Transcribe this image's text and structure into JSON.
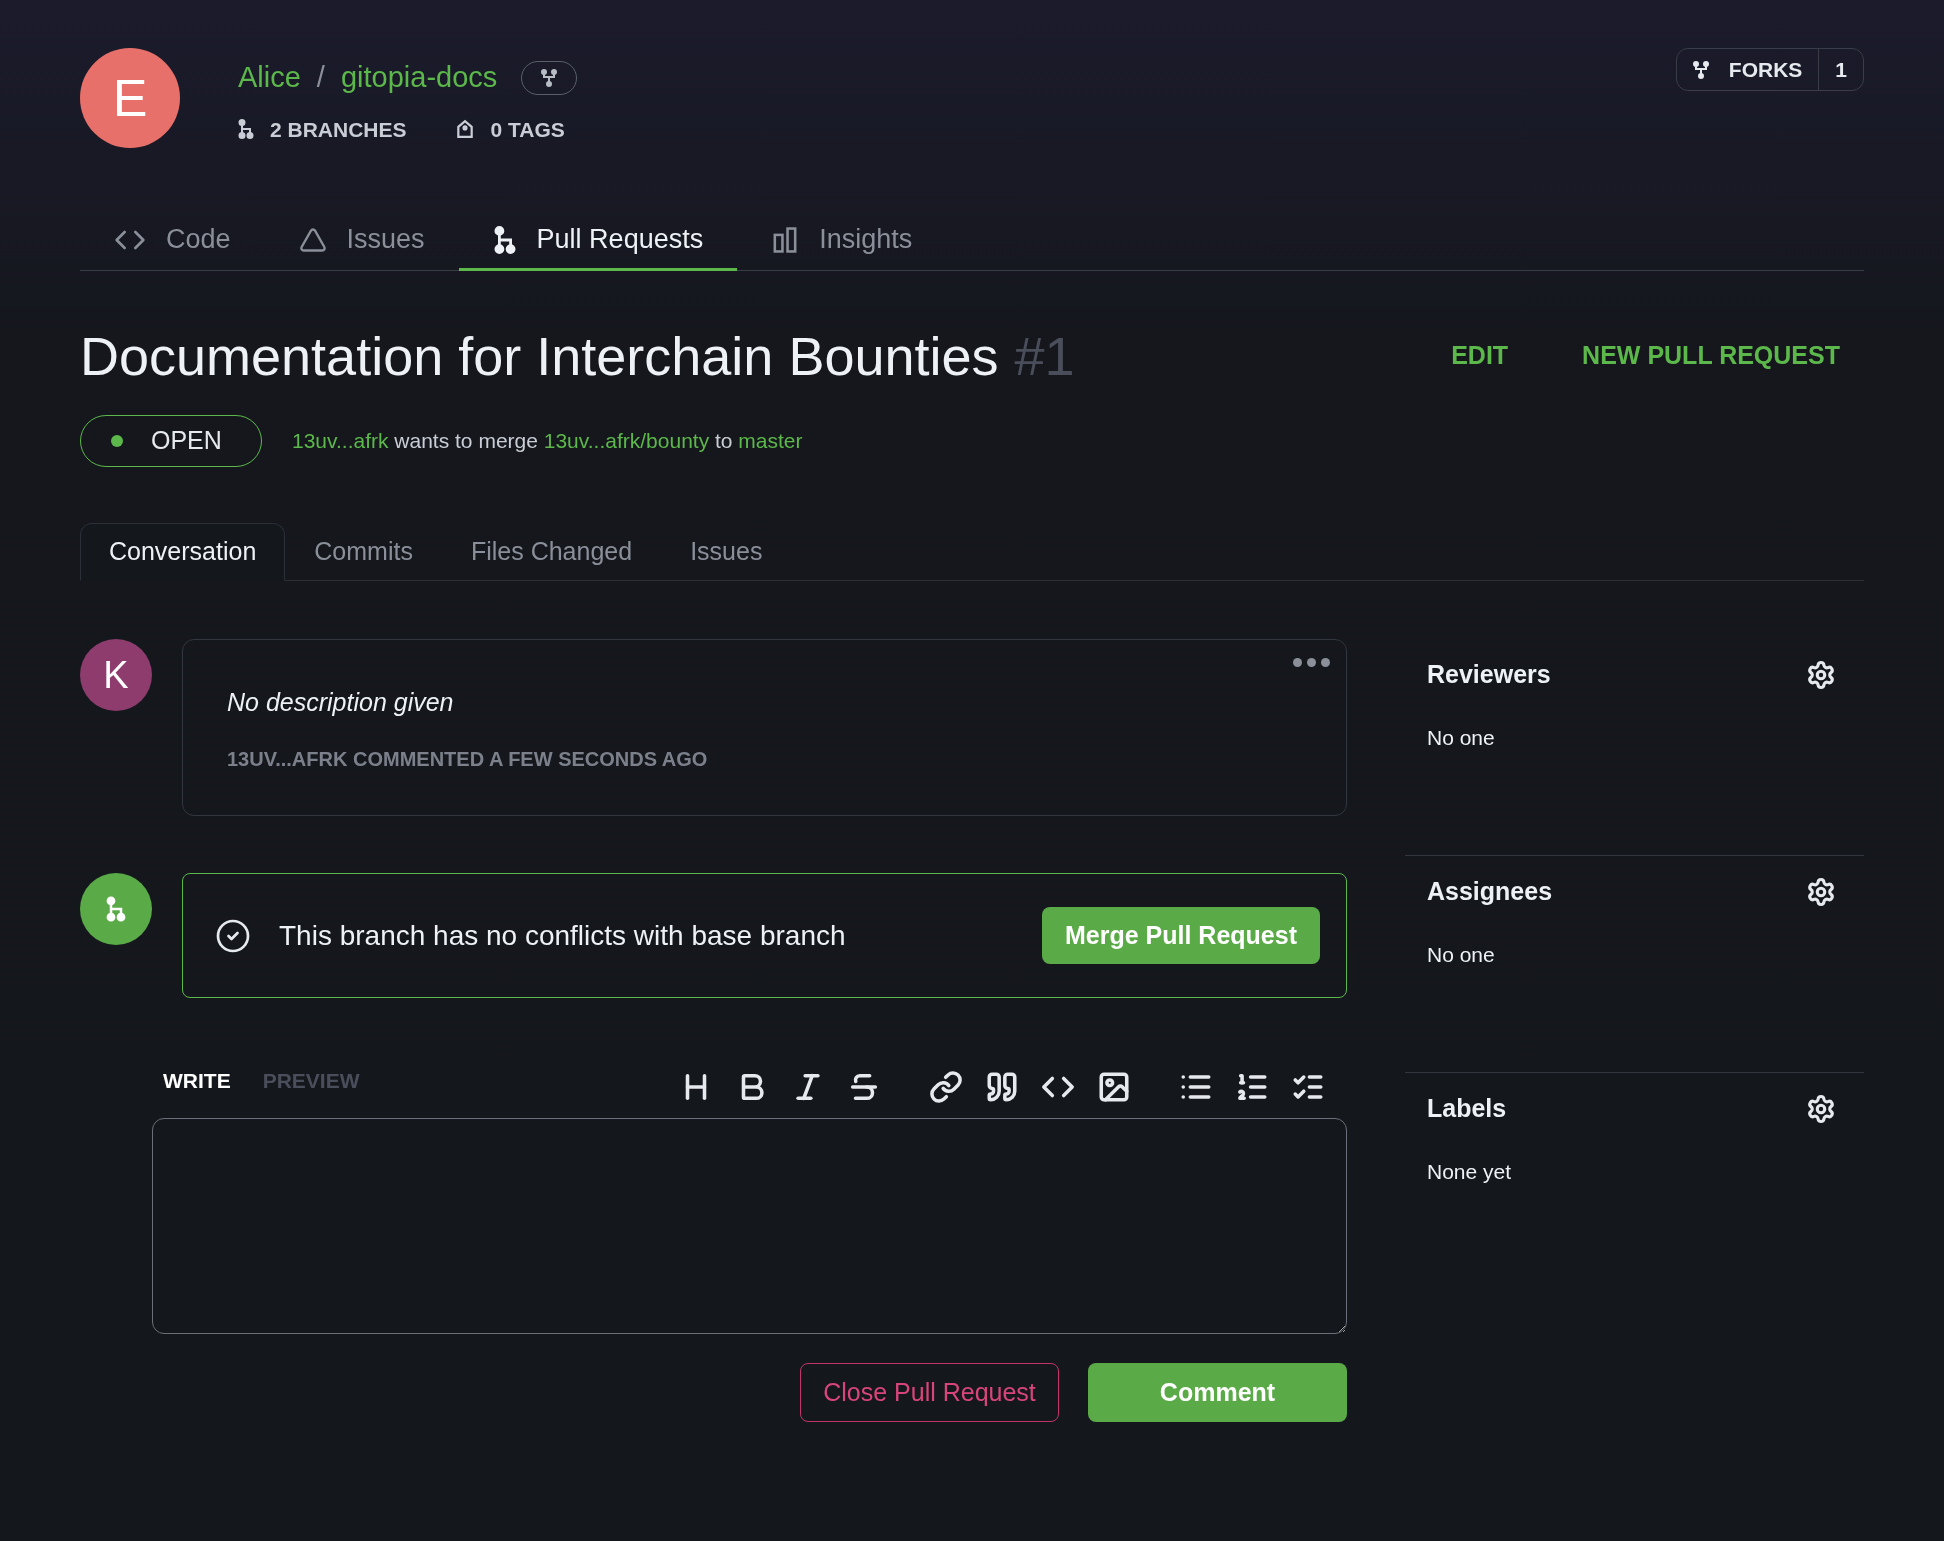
{
  "repo": {
    "avatar_letter": "E",
    "owner": "Alice",
    "separator": "/",
    "name": "gitopia-docs",
    "branches": "2 BRANCHES",
    "tags": "0 TAGS"
  },
  "forks": {
    "label": "FORKS",
    "count": "1"
  },
  "repo_tabs": [
    {
      "label": "Code",
      "kind": "code",
      "selected": false
    },
    {
      "label": "Issues",
      "kind": "issues",
      "selected": false
    },
    {
      "label": "Pull Requests",
      "kind": "pulls",
      "selected": true
    },
    {
      "label": "Insights",
      "kind": "insights",
      "selected": false
    }
  ],
  "pull_request": {
    "title": "Documentation for Interchain Bounties",
    "number": "#1",
    "actions": [
      "EDIT",
      "NEW PULL REQUEST"
    ],
    "status": "OPEN",
    "author": "13uv...afrk",
    "merge_text": "wants to merge",
    "head": "13uv...afrk/bounty",
    "to_text": "to",
    "base": "master"
  },
  "pr_tabs": [
    {
      "label": "Conversation",
      "selected": true
    },
    {
      "label": "Commits",
      "selected": false
    },
    {
      "label": "Files Changed",
      "selected": false
    },
    {
      "label": "Issues",
      "selected": false
    }
  ],
  "timeline": [
    {
      "kind": "comment",
      "avatar_letter": "K",
      "body": "No description given",
      "meta": "13UV...AFRK COMMENTED A FEW SECONDS AGO"
    },
    {
      "kind": "merge",
      "message": "This branch has no conflicts with base branch",
      "button": "Merge Pull Request"
    }
  ],
  "editor": {
    "tabs": [
      {
        "label": "WRITE",
        "selected": true
      },
      {
        "label": "PREVIEW",
        "selected": false
      }
    ],
    "close_button": "Close Pull Request",
    "comment_button": "Comment"
  },
  "sidebar": [
    {
      "title": "Reviewers",
      "value": "No one"
    },
    {
      "title": "Assignees",
      "value": "No one"
    },
    {
      "title": "Labels",
      "value": "None yet"
    }
  ]
}
